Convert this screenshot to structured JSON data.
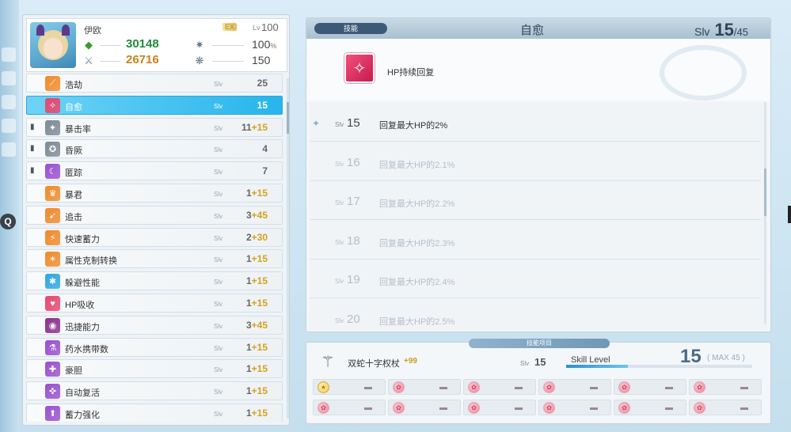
{
  "character": {
    "name": "伊欧",
    "rank_badge": "EX",
    "level_label": "Lv",
    "level": "100",
    "attack": "30148",
    "defense": "26716",
    "stat1": "100",
    "stat1_unit": "%",
    "stat2": "150"
  },
  "skills": [
    {
      "name": "浩劫",
      "slv_label": "Slv",
      "slv": "25",
      "plus": "",
      "locked": false,
      "selected": false,
      "icon": "slash-icon",
      "color": "#f08a2a"
    },
    {
      "name": "自愈",
      "slv_label": "Slv",
      "slv": "15",
      "plus": "",
      "locked": false,
      "selected": true,
      "icon": "heal-icon",
      "color": "#e8466f"
    },
    {
      "name": "暴击率",
      "slv_label": "Slv",
      "slv": "11",
      "plus": "+15",
      "locked": true,
      "selected": false,
      "icon": "crit-icon",
      "color": "#7d8a96"
    },
    {
      "name": "昏厥",
      "slv_label": "Slv",
      "slv": "4",
      "plus": "",
      "locked": true,
      "selected": false,
      "icon": "stun-icon",
      "color": "#7d8a96"
    },
    {
      "name": "匿踪",
      "slv_label": "Slv",
      "slv": "7",
      "plus": "",
      "locked": true,
      "selected": false,
      "icon": "stealth-icon",
      "color": "#9a4fd0"
    },
    {
      "name": "暴君",
      "slv_label": "Slv",
      "slv": "1",
      "plus": "+15",
      "locked": false,
      "selected": false,
      "icon": "tyrant-icon",
      "color": "#f08a2a"
    },
    {
      "name": "追击",
      "slv_label": "Slv",
      "slv": "3",
      "plus": "+45",
      "locked": false,
      "selected": false,
      "icon": "chase-icon",
      "color": "#f08a2a"
    },
    {
      "name": "快速蓄力",
      "slv_label": "Slv",
      "slv": "2",
      "plus": "+30",
      "locked": false,
      "selected": false,
      "icon": "charge-icon",
      "color": "#f08a2a"
    },
    {
      "name": "属性克制转换",
      "slv_label": "Slv",
      "slv": "1",
      "plus": "+15",
      "locked": false,
      "selected": false,
      "icon": "element-icon",
      "color": "#f08a2a"
    },
    {
      "name": "躲避性能",
      "slv_label": "Slv",
      "slv": "1",
      "plus": "+15",
      "locked": false,
      "selected": false,
      "icon": "evade-icon",
      "color": "#2ea7e0"
    },
    {
      "name": "HP吸收",
      "slv_label": "Slv",
      "slv": "1",
      "plus": "+15",
      "locked": false,
      "selected": false,
      "icon": "absorb-icon",
      "color": "#e8466f"
    },
    {
      "name": "迅捷能力",
      "slv_label": "Slv",
      "slv": "3",
      "plus": "+45",
      "locked": false,
      "selected": false,
      "icon": "swift-icon",
      "color": "#8a2f8c"
    },
    {
      "name": "药水携带数",
      "slv_label": "Slv",
      "slv": "1",
      "plus": "+15",
      "locked": false,
      "selected": false,
      "icon": "potion-icon",
      "color": "#9a4fd0"
    },
    {
      "name": "豪胆",
      "slv_label": "Slv",
      "slv": "1",
      "plus": "+15",
      "locked": false,
      "selected": false,
      "icon": "courage-icon",
      "color": "#9a4fd0"
    },
    {
      "name": "自动复活",
      "slv_label": "Slv",
      "slv": "1",
      "plus": "+15",
      "locked": false,
      "selected": false,
      "icon": "revive-icon",
      "color": "#9a4fd0"
    },
    {
      "name": "蓄力强化",
      "slv_label": "Slv",
      "slv": "1",
      "plus": "+15",
      "locked": false,
      "selected": false,
      "icon": "boost-icon",
      "color": "#9a4fd0"
    }
  ],
  "detail": {
    "tag": "技能",
    "title": "自愈",
    "slv_label": "Slv",
    "slv": "15",
    "slv_max": "/45",
    "description": "HP持续回复",
    "levels": [
      {
        "slv": "15",
        "desc": "回复最大HP的2%",
        "current": true
      },
      {
        "slv": "16",
        "desc": "回复最大HP的2.1%",
        "current": false
      },
      {
        "slv": "17",
        "desc": "回复最大HP的2.2%",
        "current": false
      },
      {
        "slv": "18",
        "desc": "回复最大HP的2.3%",
        "current": false
      },
      {
        "slv": "19",
        "desc": "回复最大HP的2.4%",
        "current": false
      },
      {
        "slv": "20",
        "desc": "回复最大HP的2.5%",
        "current": false
      }
    ]
  },
  "source": {
    "tag": "技能项目",
    "weapon_name": "双蛇十字权杖",
    "weapon_bonus": "+99",
    "slv_label": "Slv",
    "slv": "15",
    "skill_level_label": "Skill Level",
    "skill_level": "15",
    "max_label": "( MAX 45 )",
    "progress": 0.33,
    "gem_rows": [
      [
        "star",
        "pink",
        "pink",
        "pink",
        "pink",
        "pink"
      ],
      [
        "pink",
        "pink",
        "pink",
        "pink",
        "pink",
        "pink"
      ]
    ]
  },
  "colors": {
    "accent": "#27b5eb",
    "gold": "#c4a21b",
    "attack": "#1e8c3a",
    "defense": "#c9831b"
  }
}
